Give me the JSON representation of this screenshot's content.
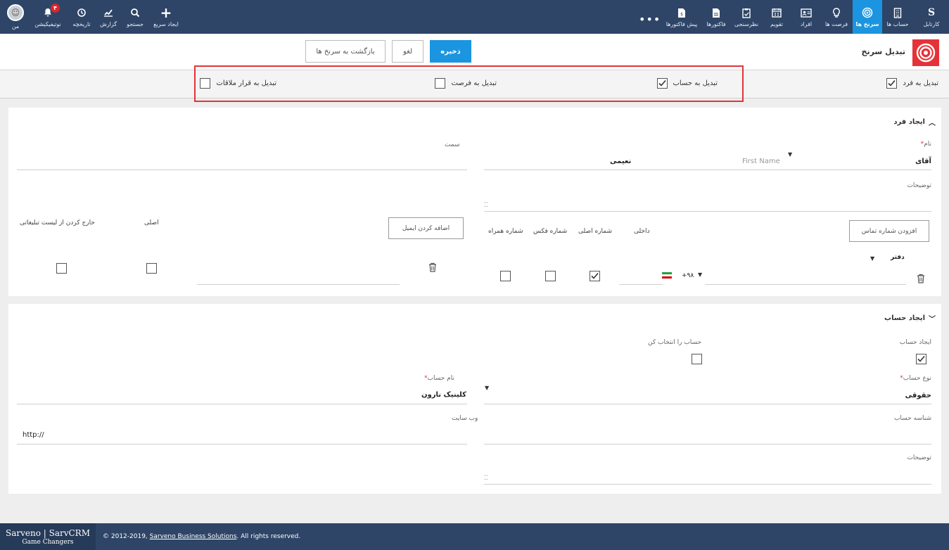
{
  "nav": {
    "left": [
      {
        "label": "من",
        "icon": "avatar"
      },
      {
        "label": "نوتیفیکیشن",
        "icon": "bell-icon",
        "badge": "۴"
      },
      {
        "label": "تاریخچه",
        "icon": "history-icon"
      },
      {
        "label": "گزارش",
        "icon": "chart-icon"
      },
      {
        "label": "جستجو",
        "icon": "search-icon"
      },
      {
        "label": "ایجاد سریع",
        "icon": "plus-icon"
      }
    ],
    "more": "•••",
    "right": [
      {
        "label": "کارتابل",
        "icon": "logo-s"
      },
      {
        "label": "حساب ها",
        "icon": "building-icon"
      },
      {
        "label": "سرنخ ها",
        "icon": "target-icon",
        "active": true
      },
      {
        "label": "فرصت ها",
        "icon": "lightbulb-icon"
      },
      {
        "label": "افراد",
        "icon": "contact-card-icon"
      },
      {
        "label": "تقویم",
        "icon": "calendar-icon"
      },
      {
        "label": "نظرسنجی",
        "icon": "clipboard-icon"
      },
      {
        "label": "فاکتورها",
        "icon": "invoice-icon"
      },
      {
        "label": "پیش فاکتورها",
        "icon": "quote-icon"
      }
    ]
  },
  "header": {
    "title": "تبدیل سرنخ",
    "save": "ذخیره",
    "cancel": "لغو",
    "back": "بازگشت به سرنخ ها"
  },
  "convert": {
    "to_person": {
      "label": "تبدیل به فرد",
      "checked": true
    },
    "to_account": {
      "label": "تبدیل به حساب",
      "checked": true
    },
    "to_opportunity": {
      "label": "تبدیل به فرصت",
      "checked": false
    },
    "to_meeting": {
      "label": "تبدیل به قرار ملاقات",
      "checked": false
    }
  },
  "person": {
    "section_title": "ایجاد فرد",
    "name_label": "نام",
    "salutation": "آقای",
    "first_name_placeholder": "First Name",
    "last_name": "نعیمی",
    "position_label": "سمت",
    "description_label": "توضیحات",
    "add_phone": "افزودن شماره تماس",
    "phone_cols": {
      "extension": "داخلی",
      "primary": "شماره اصلی",
      "fax": "شماره فکس",
      "mobile": "شماره همراه"
    },
    "phone_type": "دفتر",
    "country_code": "+۹۸",
    "phone_flags": {
      "primary": true,
      "fax": false,
      "mobile": false
    },
    "add_email": "اضافه کردن ایمیل",
    "email_cols": {
      "primary": "اصلی",
      "exclude": "خارج کردن از لیست تبلیغاتی"
    },
    "email_flags": {
      "primary": false,
      "exclude": false
    }
  },
  "account": {
    "section_title": "ایجاد حساب",
    "create_label": "ایجاد حساب",
    "create_checked": true,
    "select_label": "حساب را انتخاب کن",
    "select_checked": false,
    "type_label": "نوع حساب",
    "type_value": "حقوقی",
    "name_label": "نام حساب",
    "name_value": "کلینیک نارون",
    "id_label": "شناسه حساب",
    "website_label": "وب سایت",
    "website_value": "http://",
    "description_label": "توضیحات"
  },
  "footer": {
    "brand": "Sarveno | SarvCRM",
    "tagline": "Game Changers",
    "copy_prefix": "© 2012-2019, ",
    "copy_link": "Sarveno Business Solutions",
    "copy_suffix": ". All rights reserved."
  },
  "colors": {
    "nav_bg": "#2e4567",
    "accent": "#1b95e0",
    "highlight": "#e53238"
  }
}
